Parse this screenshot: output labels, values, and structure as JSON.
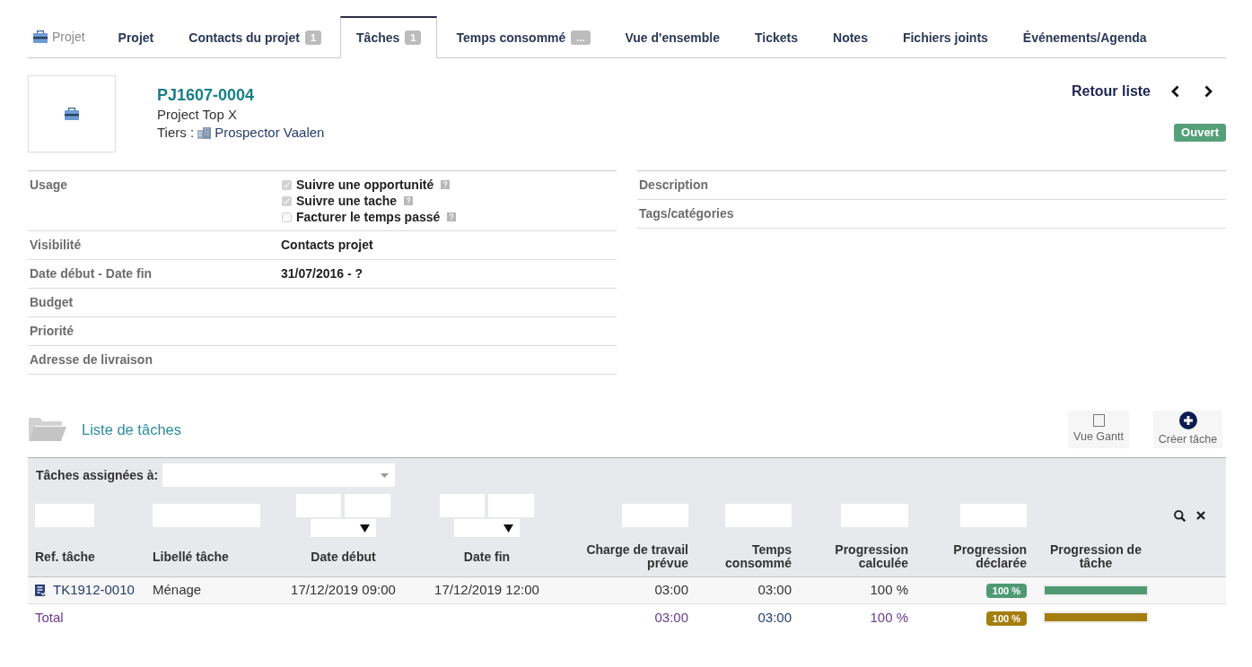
{
  "tabs_title": "Projet",
  "tabs": [
    {
      "label": "Projet",
      "selected": false
    },
    {
      "label": "Contacts du projet",
      "badge": "1",
      "selected": false
    },
    {
      "label": "Tâches",
      "badge": "1",
      "selected": true
    },
    {
      "label": "Temps consommé",
      "badge": "...",
      "selected": false
    },
    {
      "label": "Vue d'ensemble",
      "selected": false
    },
    {
      "label": "Tickets",
      "selected": false
    },
    {
      "label": "Notes",
      "selected": false
    },
    {
      "label": "Fichiers joints",
      "selected": false
    },
    {
      "label": "Événements/Agenda",
      "selected": false
    }
  ],
  "header": {
    "ref": "PJ1607-0004",
    "title": "Project Top X",
    "third_party_label": "Tiers :",
    "third_party": "Prospector Vaalen",
    "back_link": "Retour liste",
    "status": "Ouvert"
  },
  "fields_left": [
    {
      "label": "Usage",
      "kind": "checklist",
      "options": [
        {
          "label": "Suivre une opportunité",
          "checked": true,
          "disabled": true
        },
        {
          "label": "Suivre une tache",
          "checked": true,
          "disabled": true
        },
        {
          "label": "Facturer le temps passé",
          "checked": false,
          "disabled": true
        }
      ]
    },
    {
      "label": "Visibilité",
      "kind": "text",
      "value": "Contacts projet"
    },
    {
      "label": "Date début - Date fin",
      "kind": "text",
      "value": "31/07/2016 - ?"
    },
    {
      "label": "Budget",
      "kind": "text"
    },
    {
      "label": "Priorité",
      "kind": "text"
    },
    {
      "label": "Adresse de livraison",
      "kind": "text"
    }
  ],
  "fields_right": [
    {
      "label": "Description"
    },
    {
      "label": "Tags/catégories"
    }
  ],
  "task_list": {
    "title": "Liste de tâches",
    "buttons": [
      {
        "label": "Vue Gantt",
        "kind": "gantt"
      },
      {
        "label": "Créer tâche",
        "kind": "create"
      }
    ],
    "assignee_filter": {
      "label": "Tâches assignées à:"
    },
    "columns": [
      {
        "label": "Ref. tâche",
        "kind": "text"
      },
      {
        "label": "Libellé tâche",
        "kind": "text"
      },
      {
        "label": "Date début",
        "kind": "date"
      },
      {
        "label": "Date fin",
        "kind": "date"
      },
      {
        "label": "Charge de travail prévue",
        "kind": "text"
      },
      {
        "label": "Temps consommé",
        "kind": "text"
      },
      {
        "label": "Progression calculée",
        "kind": "text"
      },
      {
        "label": "Progression déclarée",
        "kind": "text"
      },
      {
        "label": "Progression de tâche",
        "kind": "progress"
      }
    ],
    "rows": [
      {
        "ref": "TK1912-0010",
        "name": "Ménage",
        "start": "17/12/2019 09:00",
        "end": "17/12/2019 12:00",
        "planned": "03:00",
        "spent": "03:00",
        "calculated": "100 %",
        "declared": "100 %",
        "level": 1,
        "color": "#4f9a74"
      }
    ],
    "total": {
      "label": "Total",
      "planned": "03:00",
      "spent": "03:00",
      "calculated": "100 %",
      "declared": "100 %",
      "level": 1,
      "color": "#a47e0e"
    }
  }
}
